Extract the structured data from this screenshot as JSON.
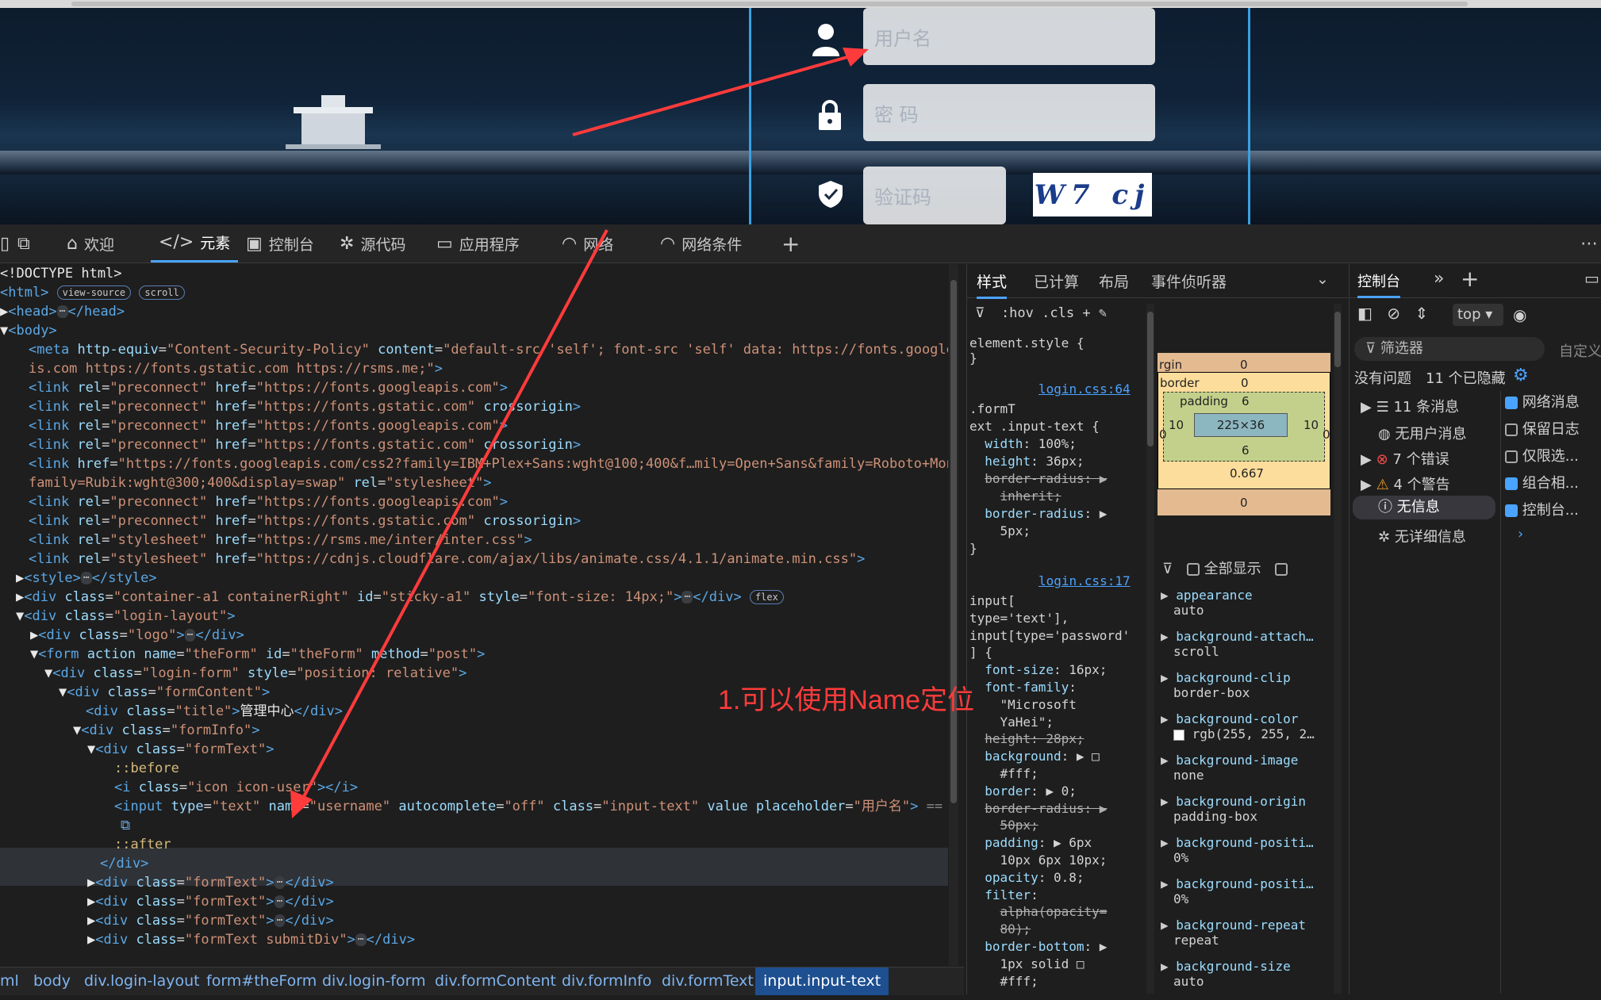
{
  "webpage": {
    "username_placeholder": "用户名",
    "password_placeholder": "密  码",
    "captcha_placeholder": "验证码",
    "captcha_text": "W7 cj"
  },
  "devtools_tabs": [
    {
      "label": "欢迎",
      "icon": "home-icon"
    },
    {
      "label": "元素",
      "icon": "code-icon"
    },
    {
      "label": "控制台",
      "icon": "console-icon"
    },
    {
      "label": "源代码",
      "icon": "bug-icon"
    },
    {
      "label": "应用程序",
      "icon": "app-icon"
    },
    {
      "label": "网络",
      "icon": "wifi-icon"
    },
    {
      "label": "网络条件",
      "icon": "wifi-gear-icon"
    }
  ],
  "tree": {
    "doctype": "<!DOCTYPE html>",
    "badge_view_source": "view-source",
    "badge_scroll": "scroll",
    "badge_flex": "flex",
    "csp_content": "default-src 'self'; font-src 'self' data: https://fonts.googleap",
    "csp_content2": "is.com https://fonts.gstatic.com https://rsms.me;",
    "href_googleapis": "https://fonts.googleapis.com",
    "href_gstatic": "https://fonts.gstatic.com",
    "href_css2": "https://fonts.googleapis.com/css2?family=IBM+Plex+Sans:wght@100;400&f…mily=Open+Sans&family=Roboto+Mono&",
    "href_css2_cont": "family=Rubik:wght@300;400&display=swap",
    "href_inter": "https://rsms.me/inter/inter.css",
    "href_animate": "https://cdnjs.cloudflare.com/ajax/libs/animate.css/4.1.1/animate.min.css",
    "title_text": "管理中心",
    "placeholder_value": "用户名",
    "eq_dollar": "== $0"
  },
  "breadcrumbs": [
    "ml",
    "body",
    "div.login-layout",
    "form#theForm",
    "div.login-form",
    "div.formContent",
    "div.formInfo",
    "div.formText",
    "input.input-text"
  ],
  "styles": {
    "tabs": [
      "样式",
      "已计算",
      "布局",
      "事件侦听器"
    ],
    "filter_hov": ":hov",
    "filter_cls": ".cls",
    "element_style": "element.style {",
    "link1": "login.css:64",
    "link2": "login.css:17",
    "show_all": "全部显示",
    "computed": [
      {
        "name": "appearance",
        "value": "auto"
      },
      {
        "name": "background-attach…",
        "value": "scroll"
      },
      {
        "name": "background-clip",
        "value": "border-box"
      },
      {
        "name": "background-color",
        "value": "rgb(255, 255, 2…"
      },
      {
        "name": "background-image",
        "value": "none"
      },
      {
        "name": "background-origin",
        "value": "padding-box"
      },
      {
        "name": "background-positi…",
        "value": "0%"
      },
      {
        "name": "background-positi…",
        "value": "0%"
      },
      {
        "name": "background-repeat",
        "value": "repeat"
      },
      {
        "name": "background-size",
        "value": "auto"
      }
    ],
    "boxmodel": {
      "margin_label": "rgin",
      "margin": "0",
      "border_label": "border",
      "border": "0",
      "padding_label": "padding",
      "padding_top": "6",
      "padding_side": "10",
      "content": "225×36",
      "padding_bottom": "6",
      "border_bottom": "0.667",
      "margin_bottom": "0",
      "side_zero": "0"
    }
  },
  "console": {
    "tab": "控制台",
    "context": "top",
    "filter_placeholder": "筛选器",
    "custom": "自定义",
    "no_issues": "没有问题",
    "hidden": "11 个已隐藏",
    "items": [
      {
        "label": "11 条消息",
        "icon": "list-icon"
      },
      {
        "label": "无用户消息",
        "icon": "user-icon"
      },
      {
        "label": "7 个错误",
        "icon": "error-icon"
      },
      {
        "label": "4 个警告",
        "icon": "warning-icon"
      },
      {
        "label": "无信息",
        "icon": "info-icon"
      },
      {
        "label": "无详细信息",
        "icon": "verbose-icon"
      }
    ],
    "options": [
      {
        "label": "网络消息",
        "checked": true
      },
      {
        "label": "保留日志",
        "checked": false
      },
      {
        "label": "仅限选...",
        "checked": false
      },
      {
        "label": "组合相...",
        "checked": true
      },
      {
        "label": "控制台...",
        "checked": true
      }
    ]
  },
  "annotation": "1.可以使用Name定位",
  "colors": {
    "accent": "#4aa3ff",
    "arrow": "#ff3b3b",
    "panel_border": "#3aa0e0"
  }
}
